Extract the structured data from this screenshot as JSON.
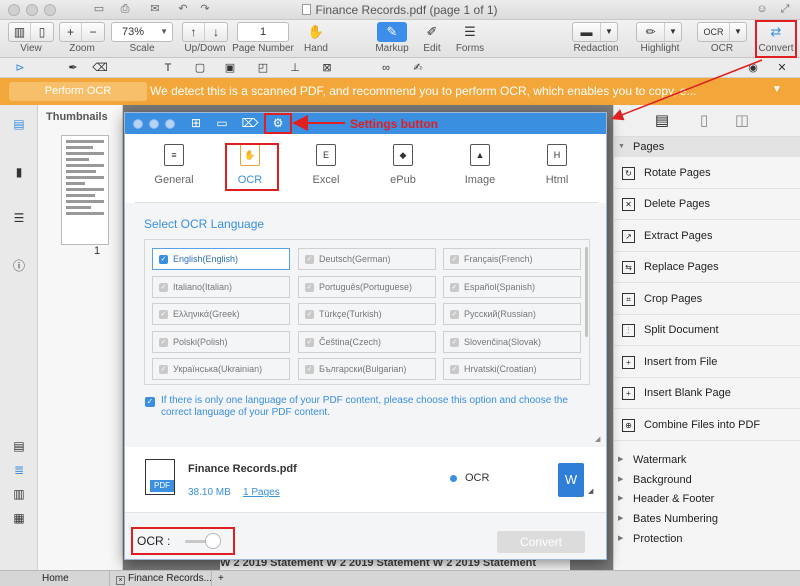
{
  "window": {
    "title": "Finance Records.pdf (page 1 of 1)"
  },
  "toolbar": {
    "view_label": "View",
    "zoom_label": "Zoom",
    "scale_value": "73%",
    "scale_label": "Scale",
    "updown_label": "Up/Down",
    "page_number_value": "1",
    "page_number_label": "Page Number",
    "hand_label": "Hand",
    "markup_label": "Markup",
    "edit_label": "Edit",
    "forms_label": "Forms",
    "redaction_label": "Redaction",
    "highlight_label": "Highlight",
    "ocr_label": "OCR",
    "convert_label": "Convert"
  },
  "banner": {
    "button_label": "Perform OCR",
    "message": "We detect this is a scanned PDF, and recommend you to perform OCR, which enables you to copy, e..."
  },
  "thumbnails": {
    "title": "Thumbnails",
    "page_number": "1"
  },
  "dialog": {
    "tabs": [
      "General",
      "OCR",
      "Excel",
      "ePub",
      "Image",
      "Html"
    ],
    "tab_icons": [
      "doc-icon",
      "ocr-icon",
      "excel-icon",
      "epub-icon",
      "image-icon",
      "html-icon"
    ],
    "active_tab": "OCR",
    "heading": "Select OCR Language",
    "languages": [
      {
        "label": "English(English)",
        "checked": true
      },
      {
        "label": "Deutsch(German)",
        "checked": false
      },
      {
        "label": "Français(French)",
        "checked": false
      },
      {
        "label": "Italiano(Italian)",
        "checked": false
      },
      {
        "label": "Português(Portuguese)",
        "checked": false
      },
      {
        "label": "Español(Spanish)",
        "checked": false
      },
      {
        "label": "Ελληνικά(Greek)",
        "checked": false
      },
      {
        "label": "Türkçe(Turkish)",
        "checked": false
      },
      {
        "label": "Русский(Russian)",
        "checked": false
      },
      {
        "label": "Polski(Polish)",
        "checked": false
      },
      {
        "label": "Čeština(Czech)",
        "checked": false
      },
      {
        "label": "Slovenčina(Slovak)",
        "checked": false
      },
      {
        "label": "Українська(Ukrainian)",
        "checked": false
      },
      {
        "label": "Български(Bulgarian)",
        "checked": false
      },
      {
        "label": "Hrvatski(Croatian)",
        "checked": false
      }
    ],
    "hint": "If there is only one language of your PDF content, please choose this option and choose the correct language of your PDF content.",
    "file": {
      "name": "Finance Records.pdf",
      "size": "38.10 MB",
      "pages": "1 Pages",
      "badge": "PDF",
      "output_option": "OCR",
      "word_letter": "W"
    },
    "footer": {
      "ocr_label": "OCR :",
      "convert_label": "Convert"
    }
  },
  "annotation": {
    "settings_label": "Settings button"
  },
  "right_panel": {
    "pages_section": "Pages",
    "items": [
      "Rotate Pages",
      "Delete Pages",
      "Extract Pages",
      "Replace Pages",
      "Crop Pages",
      "Split Document",
      "Insert from File",
      "Insert Blank Page",
      "Combine Files into PDF"
    ],
    "sections": [
      "Watermark",
      "Background",
      "Header & Footer",
      "Bates Numbering",
      "Protection"
    ]
  },
  "document": {
    "footer_text": "W 2 2019 Statement W 2 2019 Statement W 2 2019 Statement"
  },
  "bottom_tabs": {
    "home": "Home",
    "doc": "Finance Records....",
    "add": "+"
  },
  "colors": {
    "accent": "#3a8fe0",
    "banner": "#f3a73a",
    "annotation": "#e02020"
  }
}
